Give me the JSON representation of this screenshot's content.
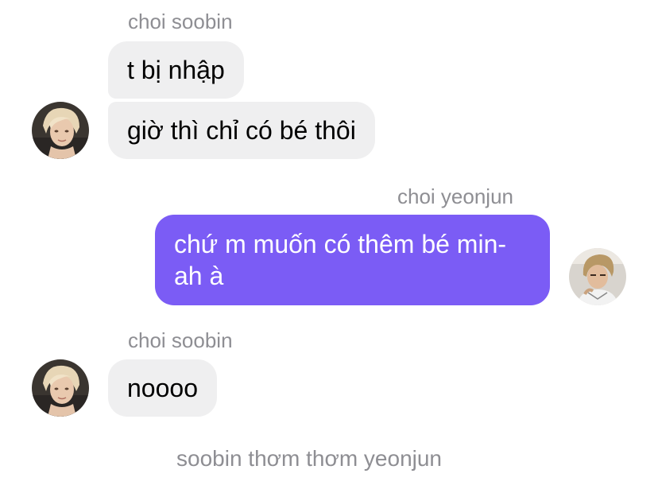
{
  "messages": [
    {
      "sender": "choi soobin",
      "bubbles": [
        "t bị nhập",
        "giờ thì chỉ có bé thôi"
      ],
      "avatar_icon": "avatar-soobin",
      "direction": "incoming"
    },
    {
      "sender": "choi yeonjun",
      "bubbles": [
        "chứ m muốn có thêm bé min-ah à"
      ],
      "avatar_icon": "avatar-yeonjun",
      "direction": "outgoing"
    },
    {
      "sender": "choi soobin",
      "bubbles": [
        "noooo"
      ],
      "avatar_icon": "avatar-soobin",
      "direction": "incoming"
    }
  ],
  "footer_text": "soobin thơm thơm yeonjun",
  "colors": {
    "incoming_bubble": "#efeff0",
    "outgoing_bubble": "#7b5cf5",
    "sender_text": "#8e8e93"
  }
}
